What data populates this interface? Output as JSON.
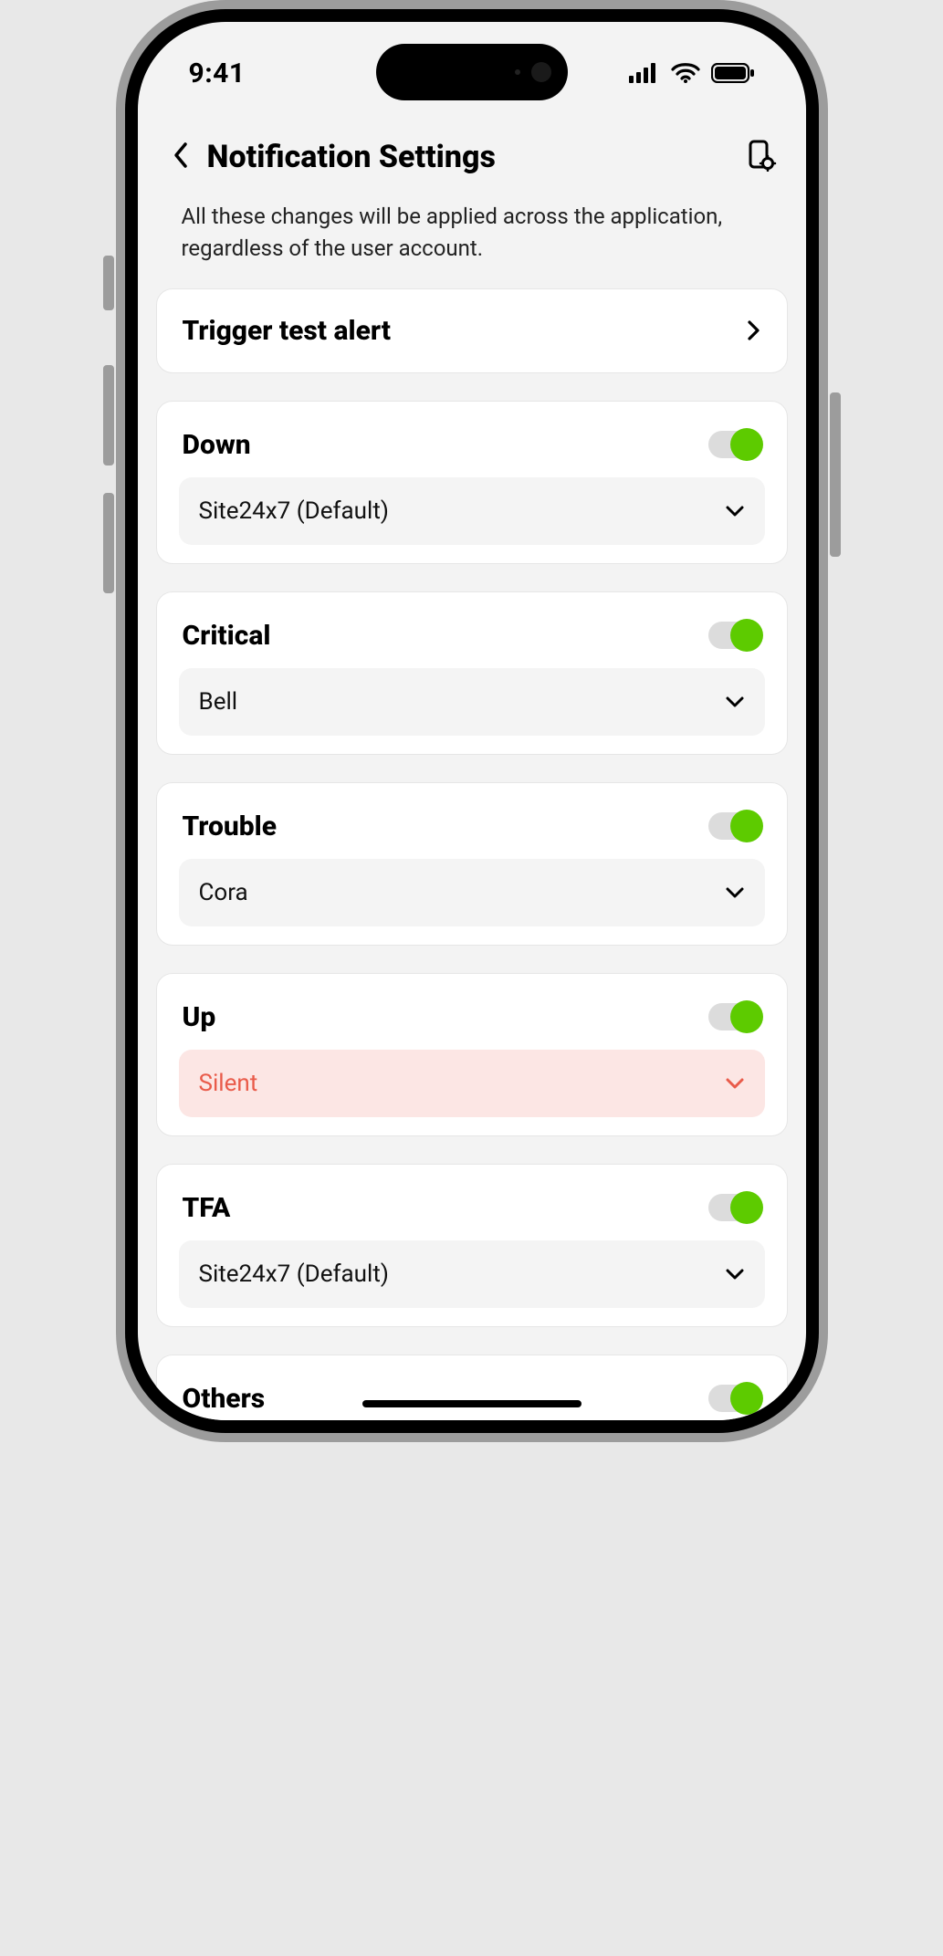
{
  "status": {
    "time": "9:41"
  },
  "header": {
    "title": "Notification Settings"
  },
  "info": "All these changes will be applied across the application, regardless of the user account.",
  "trigger": {
    "label": "Trigger test alert"
  },
  "sections": [
    {
      "title": "Down",
      "on": true,
      "option": "Site24x7 (Default)",
      "variant": "default"
    },
    {
      "title": "Critical",
      "on": true,
      "option": "Bell",
      "variant": "default"
    },
    {
      "title": "Trouble",
      "on": true,
      "option": "Cora",
      "variant": "default"
    },
    {
      "title": "Up",
      "on": true,
      "option": "Silent",
      "variant": "silent"
    },
    {
      "title": "TFA",
      "on": true,
      "option": "Site24x7 (Default)",
      "variant": "default"
    },
    {
      "title": "Others",
      "on": true
    }
  ]
}
